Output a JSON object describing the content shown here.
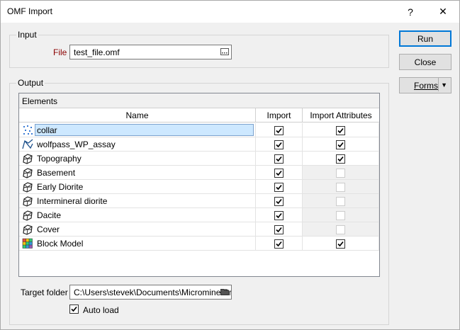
{
  "window": {
    "title": "OMF Import",
    "help_glyph": "?",
    "close_glyph": "✕"
  },
  "input_group": {
    "label": "Input",
    "file_label": "File",
    "file_value": "test_file.omf"
  },
  "output_group": {
    "label": "Output",
    "elements_title": "Elements",
    "columns": [
      "Name",
      "Import",
      "Import Attributes"
    ],
    "rows": [
      {
        "name": "collar",
        "icon": "points-icon",
        "import": true,
        "import_attributes": true,
        "attributes_enabled": true,
        "selected": true
      },
      {
        "name": "wolfpass_WP_assay",
        "icon": "lineset-icon",
        "import": true,
        "import_attributes": true,
        "attributes_enabled": true,
        "selected": false
      },
      {
        "name": "Topography",
        "icon": "surface-icon",
        "import": true,
        "import_attributes": true,
        "attributes_enabled": true,
        "selected": false
      },
      {
        "name": "Basement",
        "icon": "surface-icon",
        "import": true,
        "import_attributes": false,
        "attributes_enabled": false,
        "selected": false
      },
      {
        "name": "Early Diorite",
        "icon": "surface-icon",
        "import": true,
        "import_attributes": false,
        "attributes_enabled": false,
        "selected": false
      },
      {
        "name": "Intermineral diorite",
        "icon": "surface-icon",
        "import": true,
        "import_attributes": false,
        "attributes_enabled": false,
        "selected": false
      },
      {
        "name": "Dacite",
        "icon": "surface-icon",
        "import": true,
        "import_attributes": false,
        "attributes_enabled": false,
        "selected": false
      },
      {
        "name": "Cover",
        "icon": "surface-icon",
        "import": true,
        "import_attributes": false,
        "attributes_enabled": false,
        "selected": false
      },
      {
        "name": "Block Model",
        "icon": "block-model-icon",
        "import": true,
        "import_attributes": true,
        "attributes_enabled": true,
        "selected": false
      }
    ],
    "target_folder_label": "Target folder",
    "target_folder_value": "C:\\Users\\stevek\\Documents\\Micromine Pr",
    "auto_load_label": "Auto load",
    "auto_load_checked": true
  },
  "buttons": {
    "run": "Run",
    "close": "Close",
    "forms": "Forms"
  },
  "colors": {
    "selection_fill": "#cde8ff",
    "selection_border": "#7da2ce",
    "file_label": "#8b0000",
    "focus_border": "#0078d7"
  }
}
